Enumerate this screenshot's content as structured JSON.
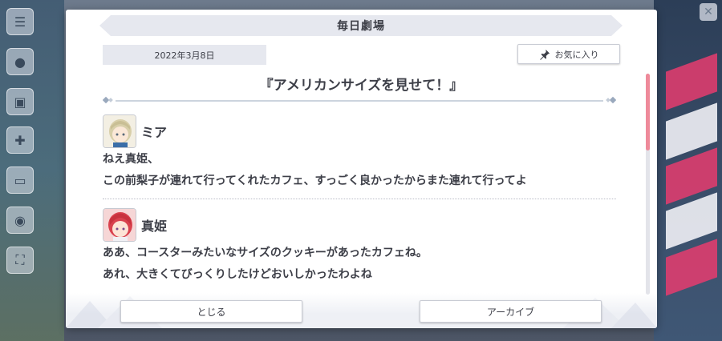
{
  "dialog": {
    "header_title": "毎日劇場",
    "date": "2022年3月8日",
    "favorite_label": "お気に入り",
    "story_title": "『アメリカンサイズを見せて！』"
  },
  "dialogue": [
    {
      "speaker": "ミア",
      "lines": [
        "ねえ真姫、",
        "この前梨子が連れて行ってくれたカフェ、すっごく良かったからまた連れて行ってよ"
      ]
    },
    {
      "speaker": "真姫",
      "lines": [
        "ああ、コースターみたいなサイズのクッキーがあったカフェね。",
        "あれ、大きくてびっくりしたけどおいしかったわよね"
      ]
    }
  ],
  "footer": {
    "close_label": "とじる",
    "archive_label": "アーカイブ"
  },
  "colors": {
    "accent_pink": "#ee8a9a",
    "header_bg": "#e6e8ef",
    "text": "#3d3f48"
  },
  "icons": {
    "favorite": "pin-icon",
    "speaker1_avatar": "mia-avatar",
    "speaker2_avatar": "maki-avatar"
  }
}
